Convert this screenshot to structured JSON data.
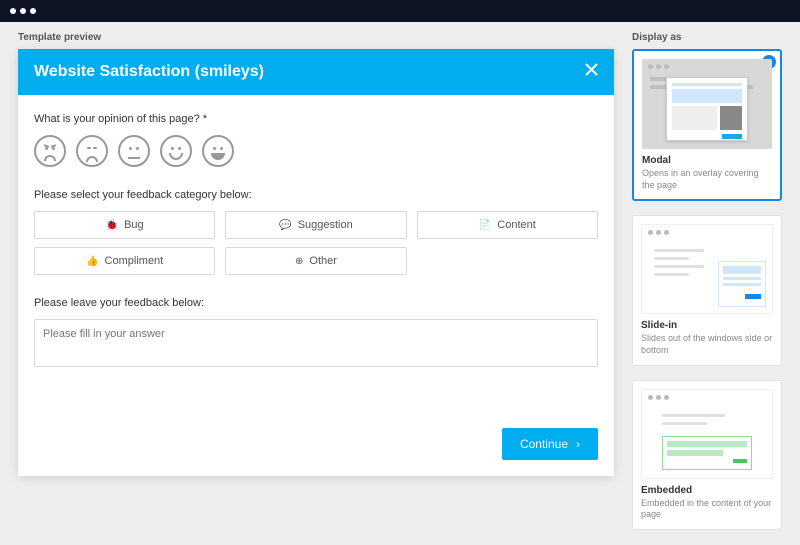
{
  "topbar": {},
  "left": {
    "section_label": "Template preview",
    "header": {
      "title": "Website Satisfaction (smileys)"
    },
    "q1": {
      "label": "What is your opinion of this page? *"
    },
    "q2": {
      "label": "Please select your feedback category below:",
      "options": {
        "bug": "Bug",
        "suggestion": "Suggestion",
        "content": "Content",
        "compliment": "Compliment",
        "other": "Other"
      }
    },
    "q3": {
      "label": "Please leave your feedback below:",
      "placeholder": "Please fill in your answer"
    },
    "continue_label": "Continue"
  },
  "right": {
    "section_label": "Display as",
    "modal": {
      "title": "Modal",
      "desc": "Opens in an overlay covering the page"
    },
    "slidein": {
      "title": "Slide-in",
      "desc": "Slides out of the windows side or bottom"
    },
    "embedded": {
      "title": "Embedded",
      "desc": "Embedded in the content of your page"
    }
  }
}
